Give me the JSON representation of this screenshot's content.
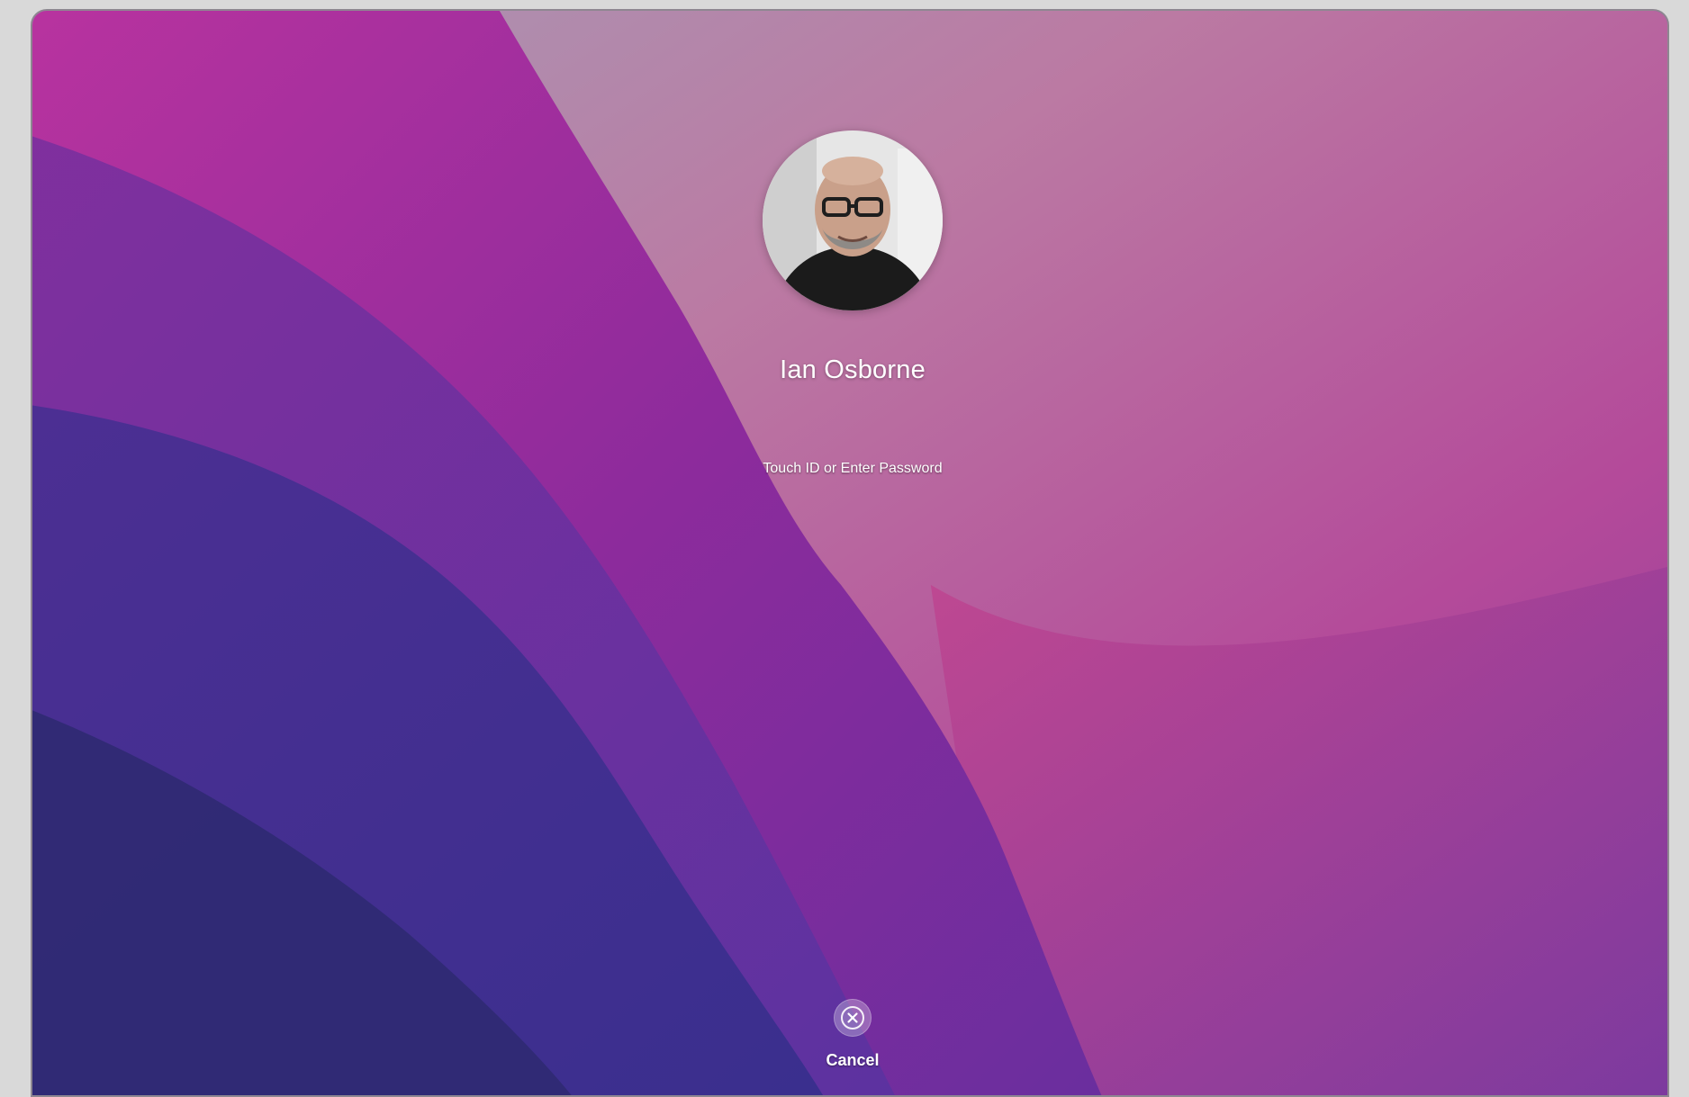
{
  "lock_screen": {
    "user_name": "Ian Osborne",
    "prompt": "Touch ID or Enter Password",
    "cancel_label": "Cancel"
  },
  "icons": {
    "avatar": "user-photo-avatar",
    "cancel": "close-circle-icon"
  },
  "colors": {
    "wallpaper_magenta": "#b02ea2",
    "wallpaper_purple": "#6a2fa3",
    "wallpaper_indigo": "#3b2b86",
    "wallpaper_grey_pink": "#b88aa5",
    "text": "#ffffff"
  }
}
